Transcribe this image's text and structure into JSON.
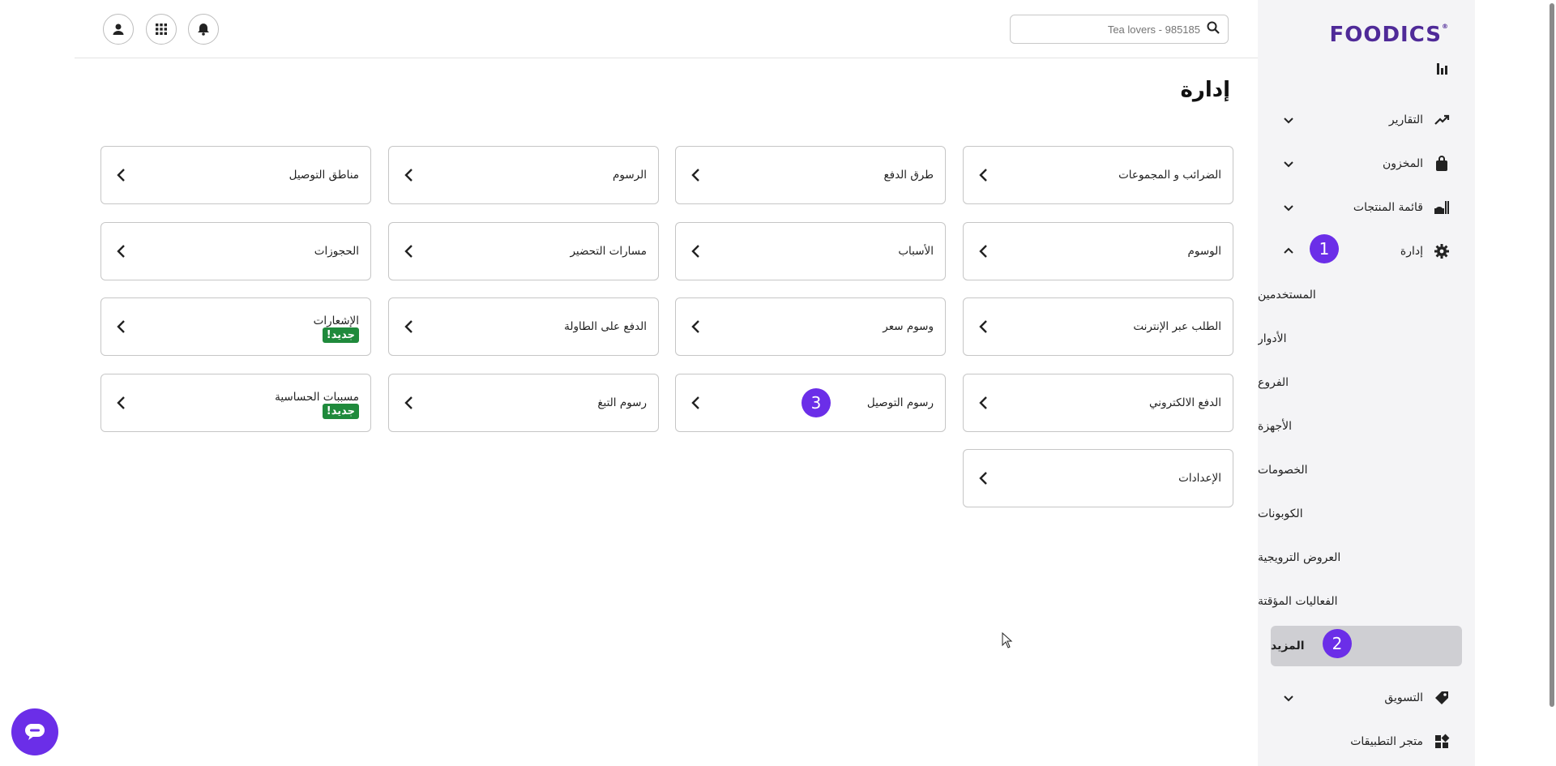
{
  "header": {
    "search_placeholder": "Tea lovers - 985185",
    "profile_icon": "user-icon",
    "apps_icon": "apps-grid-icon",
    "notifications_icon": "bell-icon"
  },
  "sidebar": {
    "logo": "FOODICS",
    "items": {
      "reports": "التقارير",
      "inventory": "المخزون",
      "menu": "قائمة المنتجات",
      "manage": "إدارة",
      "marketing": "التسويق",
      "marketplace": "متجر التطبيقات"
    },
    "sub_items": {
      "users": "المستخدمين",
      "roles": "الأدوار",
      "branches": "الفروع",
      "devices": "الأجهزة",
      "discounts": "الخصومات",
      "coupons": "الكوبونات",
      "promotions": "العروض الترويجية",
      "timed_events": "الفعاليات المؤقتة",
      "more": "المزيد"
    }
  },
  "main": {
    "title": "إدارة",
    "new_badge": "جديد!",
    "cards": {
      "taxes": "الضرائب و المجموعات",
      "payment_methods": "طرق الدفع",
      "charges": "الرسوم",
      "delivery_zones": "مناطق التوصيل",
      "tags": "الوسوم",
      "reasons": "الأسباب",
      "kitchen_flows": "مسارات التحضير",
      "reservations": "الحجوزات",
      "online_ordering": "الطلب عبر الإنترنت",
      "price_tags": "وسوم سعر",
      "pay_at_table": "الدفع على الطاولة",
      "notifications": "الإشعارات",
      "e_payment": "الدفع الالكتروني",
      "delivery_charges": "رسوم التوصيل",
      "tip_charges": "رسوم التبغ",
      "allergens": "مسببات الحساسية",
      "settings": "الإعدادات"
    }
  },
  "annotations": {
    "step1": "1",
    "step2": "2",
    "step3": "3"
  },
  "colors": {
    "brand": "#4f2a98",
    "badge": "#6b2ee8",
    "new_badge": "#1f8a3c"
  }
}
